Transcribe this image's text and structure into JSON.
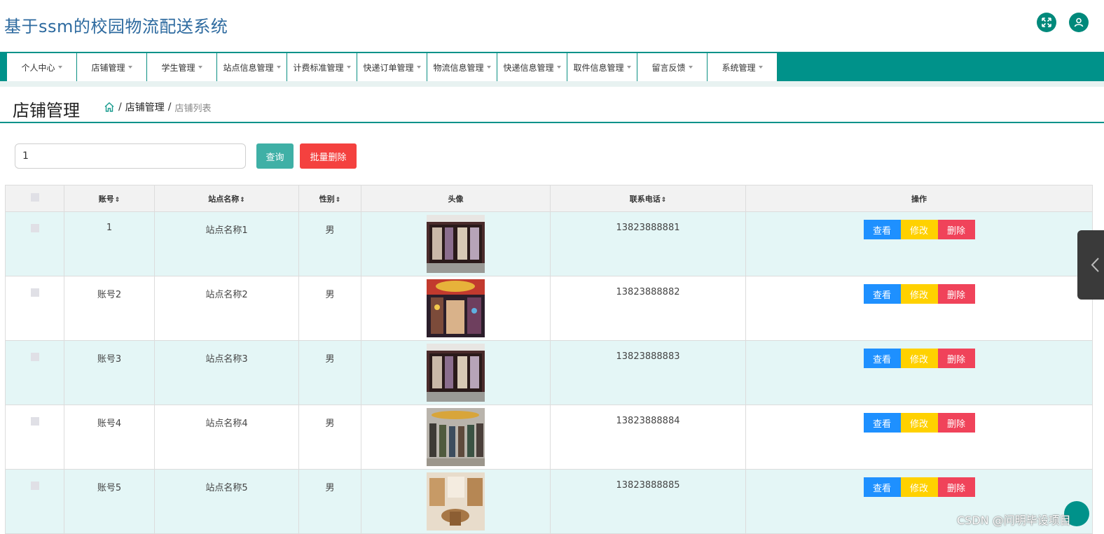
{
  "header": {
    "title": "基于ssm的校园物流配送系统",
    "expand_icon": "expand-icon",
    "user_icon": "user-icon"
  },
  "nav": {
    "items": [
      {
        "label": "个人中心"
      },
      {
        "label": "店铺管理"
      },
      {
        "label": "学生管理"
      },
      {
        "label": "站点信息管理"
      },
      {
        "label": "计费标准管理"
      },
      {
        "label": "快递订单管理"
      },
      {
        "label": "物流信息管理"
      },
      {
        "label": "快递信息管理"
      },
      {
        "label": "取件信息管理"
      },
      {
        "label": "留言反馈"
      },
      {
        "label": "系统管理"
      }
    ]
  },
  "page": {
    "title": "店铺管理",
    "breadcrumb": {
      "sep1": "/",
      "level1": "店铺管理",
      "sep2": "/",
      "level2": "店铺列表"
    }
  },
  "search": {
    "value": "1",
    "query_label": "查询",
    "batch_delete_label": "批量删除"
  },
  "table": {
    "headers": {
      "account": "账号",
      "station": "站点名称",
      "gender": "性别",
      "avatar": "头像",
      "phone": "联系电话",
      "ops": "操作",
      "sort_glyph": "⇕"
    },
    "rows": [
      {
        "account": "1",
        "station": "站点名称1",
        "gender": "男",
        "phone": "13823888881"
      },
      {
        "account": "账号2",
        "station": "站点名称2",
        "gender": "男",
        "phone": "13823888882"
      },
      {
        "account": "账号3",
        "station": "站点名称3",
        "gender": "男",
        "phone": "13823888883"
      },
      {
        "account": "账号4",
        "station": "站点名称4",
        "gender": "男",
        "phone": "13823888884"
      },
      {
        "account": "账号5",
        "station": "站点名称5",
        "gender": "男",
        "phone": "13823888885"
      }
    ],
    "actions": {
      "view": "查看",
      "edit": "修改",
      "delete": "删除"
    }
  },
  "colors": {
    "brand": "#00928a",
    "view": "#1e90ff",
    "edit": "#ffd100",
    "delete": "#f0435a"
  },
  "watermark": "CSDN @问明毕设项目"
}
